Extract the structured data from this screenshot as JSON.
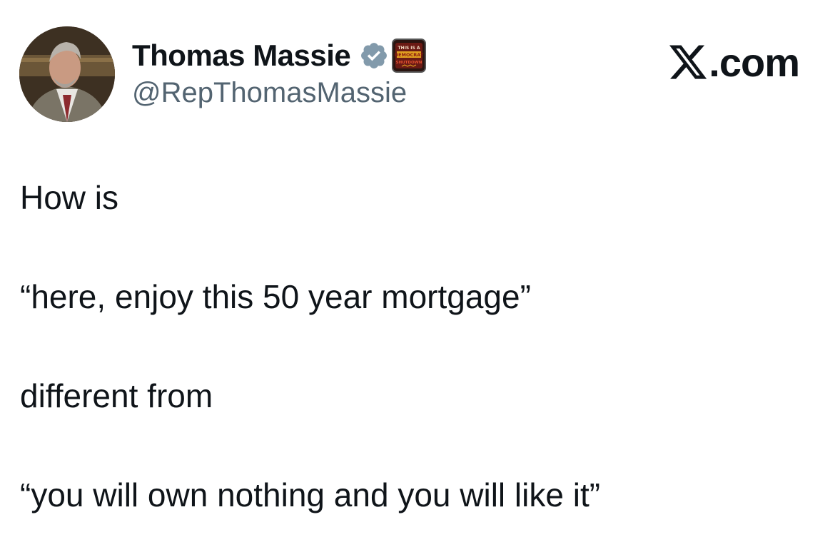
{
  "author": {
    "display_name": "Thomas Massie",
    "handle": "@RepThomasMassie",
    "verified": true,
    "avatar_icon": "profile-photo",
    "verified_icon": "verified-badge-icon",
    "affiliation_badge": {
      "icon": "shutdown-badge-icon",
      "text_lines": [
        "THIS IS A",
        "DEMOCRAT",
        "SHUTDOWN"
      ]
    }
  },
  "brand": {
    "logo_icon": "x-logo-icon",
    "domain_suffix": ".com"
  },
  "tweet": {
    "lines": [
      "How is",
      "“here, enjoy this 50 year mortgage”",
      "different from",
      "“you will own nothing and you will like it”"
    ]
  },
  "colors": {
    "text": "#0f1419",
    "secondary_text": "#536471",
    "verified": "#829aab",
    "background": "#ffffff"
  }
}
